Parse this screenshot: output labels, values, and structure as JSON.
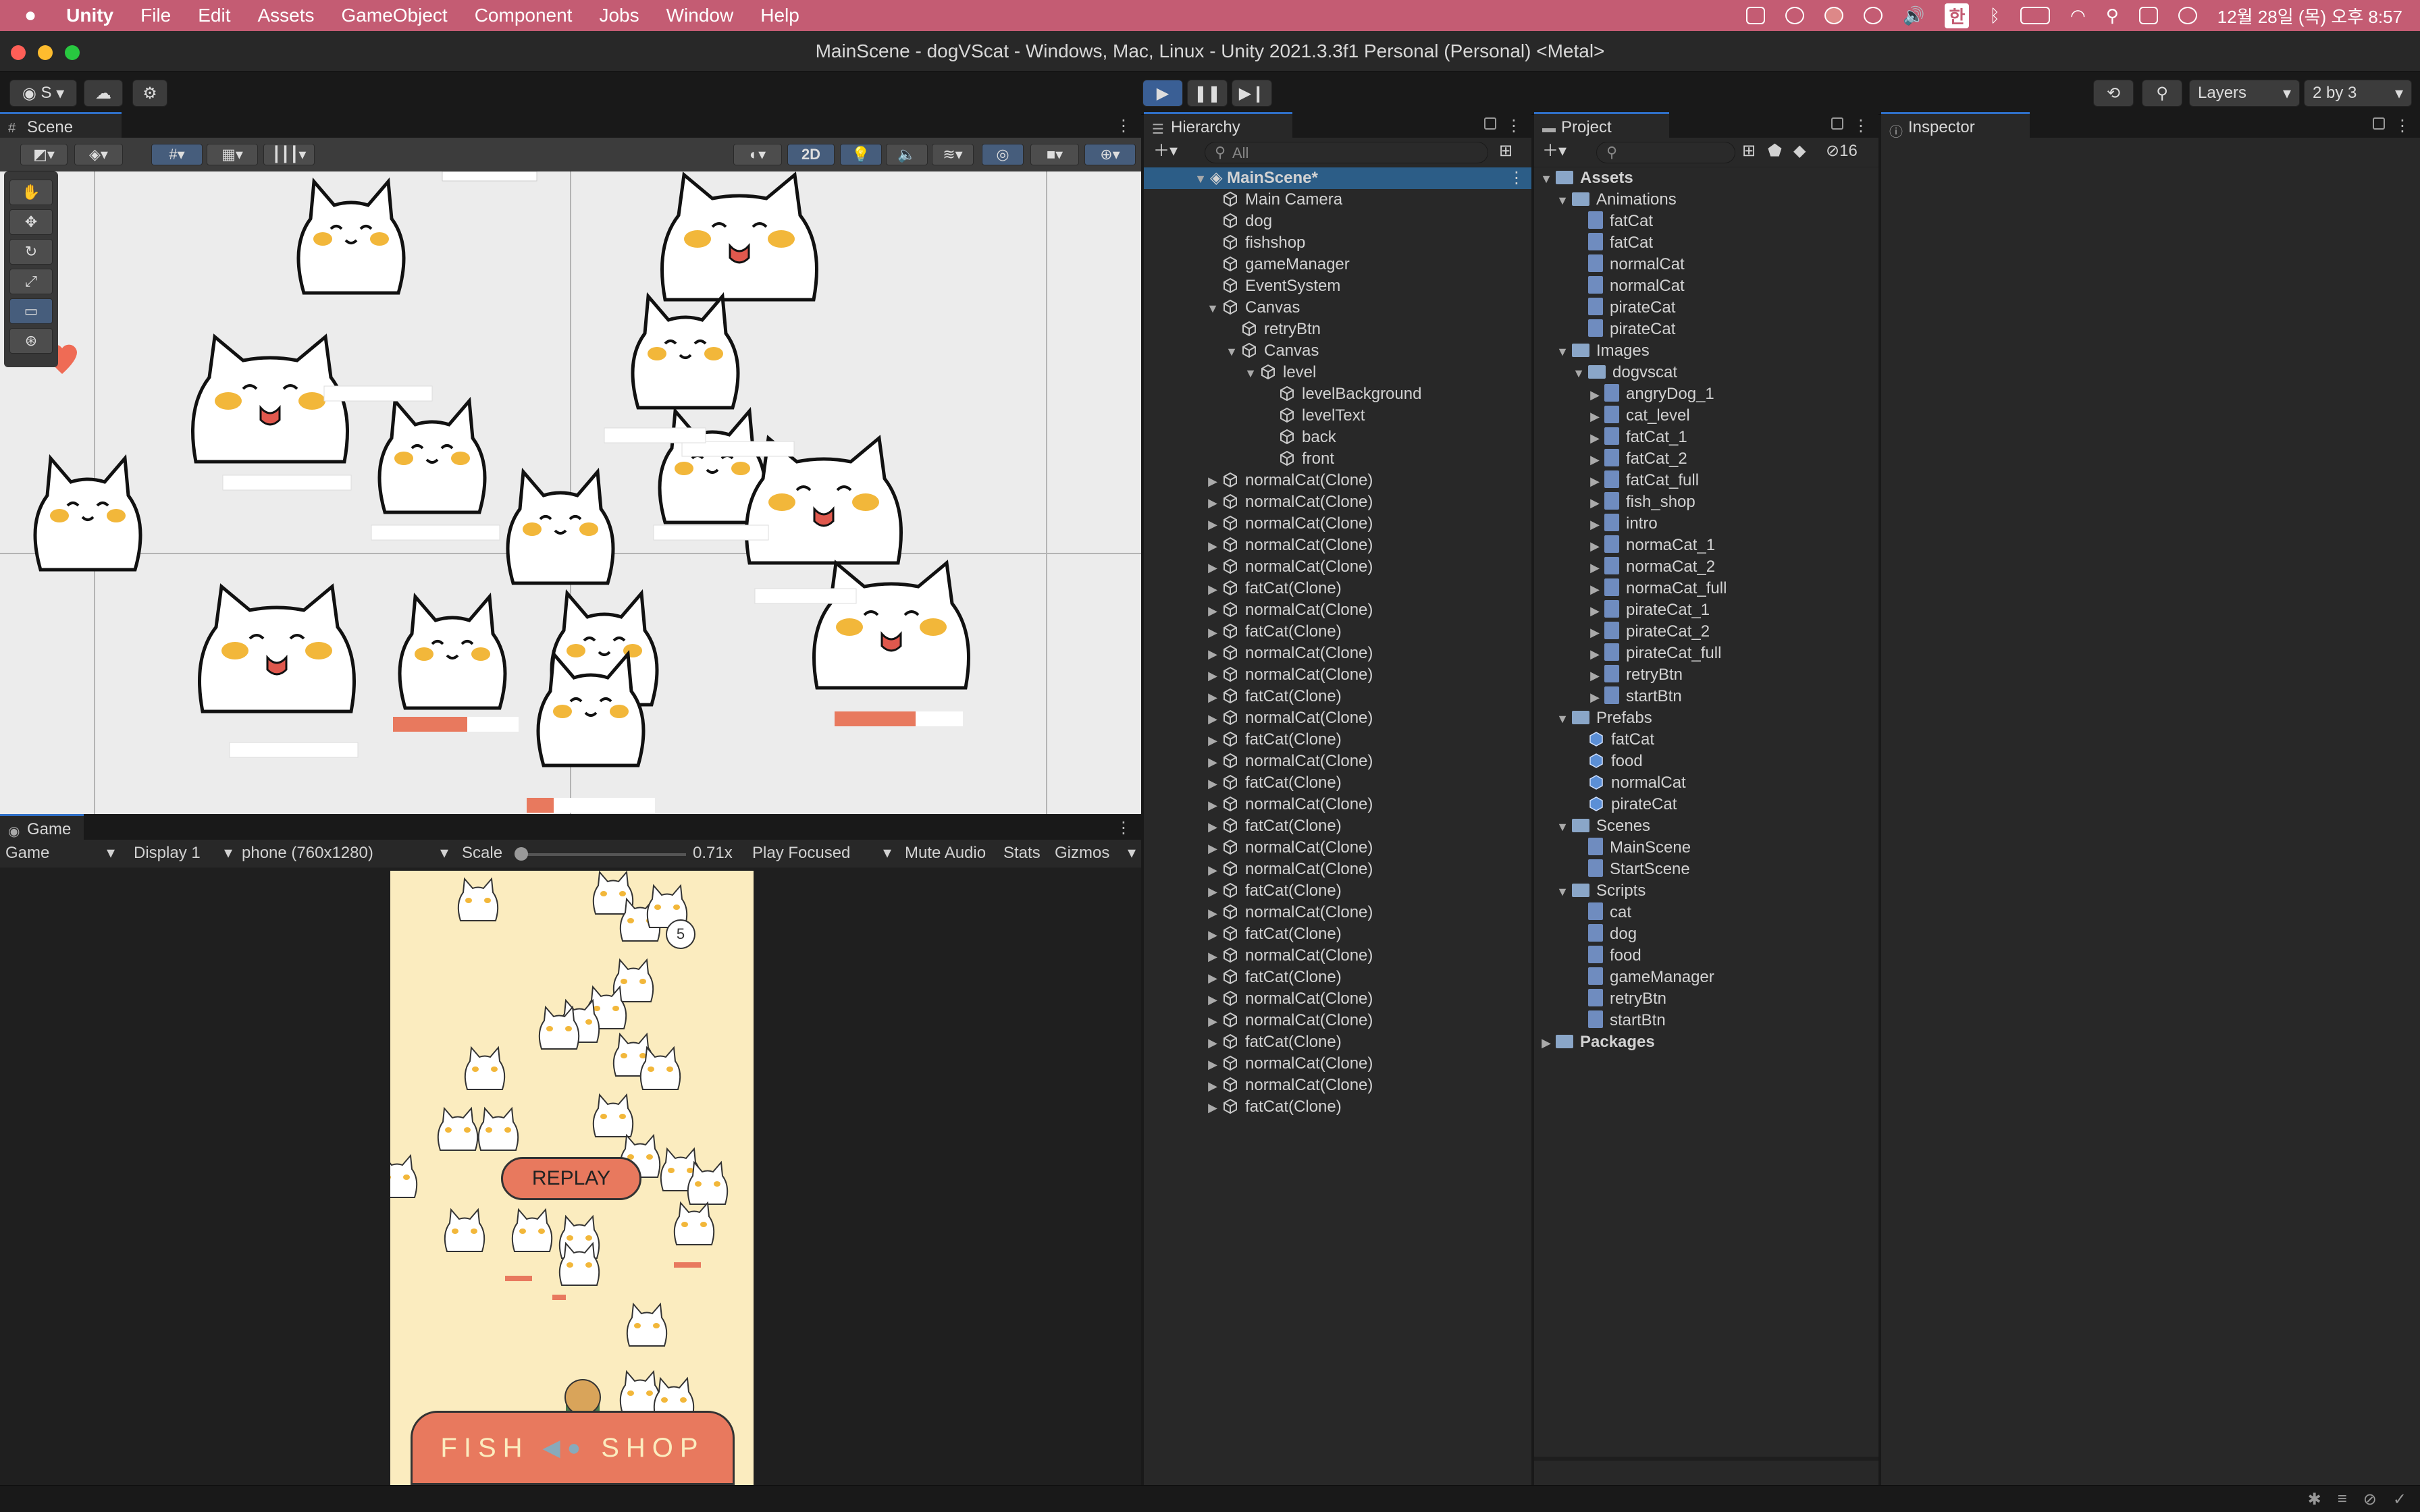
{
  "menubar": {
    "app_name": "Unity",
    "items": [
      "File",
      "Edit",
      "Assets",
      "GameObject",
      "Component",
      "Jobs",
      "Window",
      "Help"
    ],
    "ime": "한",
    "clock": "12월 28일 (목) 오후 8:57"
  },
  "window": {
    "title": "MainScene - dogVScat - Windows, Mac, Linux - Unity 2021.3.3f1 Personal (Personal) <Metal>"
  },
  "toolbar": {
    "account_label": "S",
    "layers_label": "Layers",
    "layout_label": "2 by 3"
  },
  "scene_panel": {
    "tab_label": "Scene",
    "mode_2d": "2D"
  },
  "game_panel": {
    "tab_label": "Game",
    "view_select": "Game",
    "display_select": "Display 1",
    "resolution_select": "phone (760x1280)",
    "scale_label": "Scale",
    "scale_value": "0.71x",
    "play_mode_select": "Play Focused",
    "mute_label": "Mute Audio",
    "stats_label": "Stats",
    "gizmos_label": "Gizmos",
    "replay_label": "REPLAY",
    "shop_left": "FISH",
    "shop_right": "SHOP",
    "level_number": "5"
  },
  "hierarchy": {
    "tab_label": "Hierarchy",
    "search_placeholder": "All",
    "scene_name": "MainScene*",
    "items": [
      {
        "label": "Main Camera",
        "depth": 1,
        "arrow": ""
      },
      {
        "label": "dog",
        "depth": 1,
        "arrow": ""
      },
      {
        "label": "fishshop",
        "depth": 1,
        "arrow": ""
      },
      {
        "label": "gameManager",
        "depth": 1,
        "arrow": ""
      },
      {
        "label": "EventSystem",
        "depth": 1,
        "arrow": ""
      },
      {
        "label": "Canvas",
        "depth": 1,
        "arrow": "▼"
      },
      {
        "label": "retryBtn",
        "depth": 2,
        "arrow": ""
      },
      {
        "label": "Canvas",
        "depth": 2,
        "arrow": "▼"
      },
      {
        "label": "level",
        "depth": 3,
        "arrow": "▼"
      },
      {
        "label": "levelBackground",
        "depth": 4,
        "arrow": ""
      },
      {
        "label": "levelText",
        "depth": 4,
        "arrow": ""
      },
      {
        "label": "back",
        "depth": 4,
        "arrow": ""
      },
      {
        "label": "front",
        "depth": 4,
        "arrow": ""
      },
      {
        "label": "normalCat(Clone)",
        "depth": 1,
        "arrow": "▶"
      },
      {
        "label": "normalCat(Clone)",
        "depth": 1,
        "arrow": "▶"
      },
      {
        "label": "normalCat(Clone)",
        "depth": 1,
        "arrow": "▶"
      },
      {
        "label": "normalCat(Clone)",
        "depth": 1,
        "arrow": "▶"
      },
      {
        "label": "normalCat(Clone)",
        "depth": 1,
        "arrow": "▶"
      },
      {
        "label": "fatCat(Clone)",
        "depth": 1,
        "arrow": "▶"
      },
      {
        "label": "normalCat(Clone)",
        "depth": 1,
        "arrow": "▶"
      },
      {
        "label": "fatCat(Clone)",
        "depth": 1,
        "arrow": "▶"
      },
      {
        "label": "normalCat(Clone)",
        "depth": 1,
        "arrow": "▶"
      },
      {
        "label": "normalCat(Clone)",
        "depth": 1,
        "arrow": "▶"
      },
      {
        "label": "fatCat(Clone)",
        "depth": 1,
        "arrow": "▶"
      },
      {
        "label": "normalCat(Clone)",
        "depth": 1,
        "arrow": "▶"
      },
      {
        "label": "fatCat(Clone)",
        "depth": 1,
        "arrow": "▶"
      },
      {
        "label": "normalCat(Clone)",
        "depth": 1,
        "arrow": "▶"
      },
      {
        "label": "fatCat(Clone)",
        "depth": 1,
        "arrow": "▶"
      },
      {
        "label": "normalCat(Clone)",
        "depth": 1,
        "arrow": "▶"
      },
      {
        "label": "fatCat(Clone)",
        "depth": 1,
        "arrow": "▶"
      },
      {
        "label": "normalCat(Clone)",
        "depth": 1,
        "arrow": "▶"
      },
      {
        "label": "normalCat(Clone)",
        "depth": 1,
        "arrow": "▶"
      },
      {
        "label": "fatCat(Clone)",
        "depth": 1,
        "arrow": "▶"
      },
      {
        "label": "normalCat(Clone)",
        "depth": 1,
        "arrow": "▶"
      },
      {
        "label": "fatCat(Clone)",
        "depth": 1,
        "arrow": "▶"
      },
      {
        "label": "normalCat(Clone)",
        "depth": 1,
        "arrow": "▶"
      },
      {
        "label": "fatCat(Clone)",
        "depth": 1,
        "arrow": "▶"
      },
      {
        "label": "normalCat(Clone)",
        "depth": 1,
        "arrow": "▶"
      },
      {
        "label": "normalCat(Clone)",
        "depth": 1,
        "arrow": "▶"
      },
      {
        "label": "fatCat(Clone)",
        "depth": 1,
        "arrow": "▶"
      },
      {
        "label": "normalCat(Clone)",
        "depth": 1,
        "arrow": "▶"
      },
      {
        "label": "normalCat(Clone)",
        "depth": 1,
        "arrow": "▶"
      },
      {
        "label": "fatCat(Clone)",
        "depth": 1,
        "arrow": "▶"
      }
    ]
  },
  "project": {
    "tab_label": "Project",
    "hidden_count": "16",
    "items": [
      {
        "label": "Assets",
        "depth": 0,
        "arrow": "▼",
        "kind": "folder",
        "bold": true
      },
      {
        "label": "Animations",
        "depth": 1,
        "arrow": "▼",
        "kind": "folder"
      },
      {
        "label": "fatCat",
        "depth": 2,
        "arrow": "",
        "kind": "file"
      },
      {
        "label": "fatCat",
        "depth": 2,
        "arrow": "",
        "kind": "file"
      },
      {
        "label": "normalCat",
        "depth": 2,
        "arrow": "",
        "kind": "file"
      },
      {
        "label": "normalCat",
        "depth": 2,
        "arrow": "",
        "kind": "file"
      },
      {
        "label": "pirateCat",
        "depth": 2,
        "arrow": "",
        "kind": "file"
      },
      {
        "label": "pirateCat",
        "depth": 2,
        "arrow": "",
        "kind": "file"
      },
      {
        "label": "Images",
        "depth": 1,
        "arrow": "▼",
        "kind": "folder"
      },
      {
        "label": "dogvscat",
        "depth": 2,
        "arrow": "▼",
        "kind": "folder"
      },
      {
        "label": "angryDog_1",
        "depth": 3,
        "arrow": "▶",
        "kind": "file"
      },
      {
        "label": "cat_level",
        "depth": 3,
        "arrow": "▶",
        "kind": "file"
      },
      {
        "label": "fatCat_1",
        "depth": 3,
        "arrow": "▶",
        "kind": "file"
      },
      {
        "label": "fatCat_2",
        "depth": 3,
        "arrow": "▶",
        "kind": "file"
      },
      {
        "label": "fatCat_full",
        "depth": 3,
        "arrow": "▶",
        "kind": "file"
      },
      {
        "label": "fish_shop",
        "depth": 3,
        "arrow": "▶",
        "kind": "file"
      },
      {
        "label": "intro",
        "depth": 3,
        "arrow": "▶",
        "kind": "file"
      },
      {
        "label": "normaCat_1",
        "depth": 3,
        "arrow": "▶",
        "kind": "file"
      },
      {
        "label": "normaCat_2",
        "depth": 3,
        "arrow": "▶",
        "kind": "file"
      },
      {
        "label": "normaCat_full",
        "depth": 3,
        "arrow": "▶",
        "kind": "file"
      },
      {
        "label": "pirateCat_1",
        "depth": 3,
        "arrow": "▶",
        "kind": "file"
      },
      {
        "label": "pirateCat_2",
        "depth": 3,
        "arrow": "▶",
        "kind": "file"
      },
      {
        "label": "pirateCat_full",
        "depth": 3,
        "arrow": "▶",
        "kind": "file"
      },
      {
        "label": "retryBtn",
        "depth": 3,
        "arrow": "▶",
        "kind": "file"
      },
      {
        "label": "startBtn",
        "depth": 3,
        "arrow": "▶",
        "kind": "file"
      },
      {
        "label": "Prefabs",
        "depth": 1,
        "arrow": "▼",
        "kind": "folder"
      },
      {
        "label": "fatCat",
        "depth": 2,
        "arrow": "",
        "kind": "cube"
      },
      {
        "label": "food",
        "depth": 2,
        "arrow": "",
        "kind": "cube"
      },
      {
        "label": "normalCat",
        "depth": 2,
        "arrow": "",
        "kind": "cube"
      },
      {
        "label": "pirateCat",
        "depth": 2,
        "arrow": "",
        "kind": "cube"
      },
      {
        "label": "Scenes",
        "depth": 1,
        "arrow": "▼",
        "kind": "folder"
      },
      {
        "label": "MainScene",
        "depth": 2,
        "arrow": "",
        "kind": "file"
      },
      {
        "label": "StartScene",
        "depth": 2,
        "arrow": "",
        "kind": "file"
      },
      {
        "label": "Scripts",
        "depth": 1,
        "arrow": "▼",
        "kind": "folder"
      },
      {
        "label": "cat",
        "depth": 2,
        "arrow": "",
        "kind": "file"
      },
      {
        "label": "dog",
        "depth": 2,
        "arrow": "",
        "kind": "file"
      },
      {
        "label": "food",
        "depth": 2,
        "arrow": "",
        "kind": "file"
      },
      {
        "label": "gameManager",
        "depth": 2,
        "arrow": "",
        "kind": "file"
      },
      {
        "label": "retryBtn",
        "depth": 2,
        "arrow": "",
        "kind": "file"
      },
      {
        "label": "startBtn",
        "depth": 2,
        "arrow": "",
        "kind": "file"
      },
      {
        "label": "Packages",
        "depth": 0,
        "arrow": "▶",
        "kind": "folder",
        "bold": true
      }
    ]
  },
  "inspector": {
    "tab_label": "Inspector"
  },
  "colors": {
    "menubar": "#c45c73",
    "accent": "#2f6fc6",
    "game_bg": "#fbecbf",
    "shop": "#e8795e"
  }
}
